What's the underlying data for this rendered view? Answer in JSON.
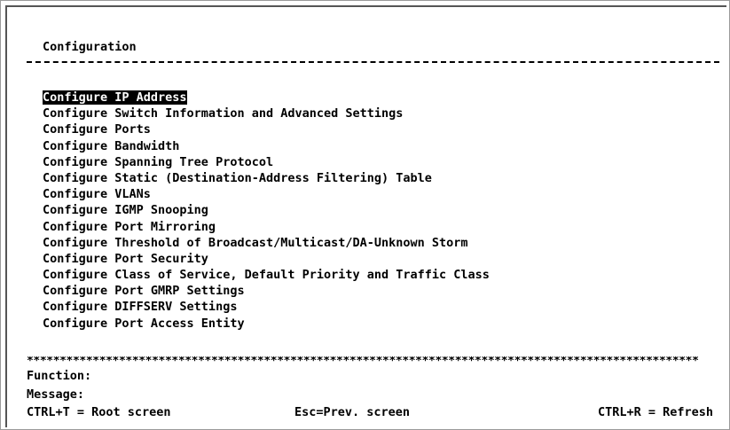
{
  "screen": {
    "title": "Configuration",
    "menu": [
      "Configure IP Address",
      "Configure Switch Information and Advanced Settings",
      "Configure Ports",
      "Configure Bandwidth",
      "Configure Spanning Tree Protocol",
      "Configure Static (Destination-Address Filtering) Table",
      "Configure VLANs",
      "Configure IGMP Snooping",
      "Configure Port Mirroring",
      "Configure Threshold of Broadcast/Multicast/DA-Unknown Storm",
      "Configure Port Security",
      "Configure Class of Service, Default Priority and Traffic Class",
      "Configure Port GMRP Settings",
      "Configure DIFFSERV Settings",
      "Configure Port Access Entity"
    ],
    "selected_index": 0,
    "separator_stars": "******************************************************************************************************",
    "function_label": "Function:",
    "message_label": "Message:",
    "status_root": "CTRL+T = Root screen",
    "status_prev": "Esc=Prev. screen",
    "status_refresh": "CTRL+R = Refresh"
  },
  "colors": {
    "background": "#ffffff",
    "text": "#000000",
    "highlight_bg": "#000000",
    "highlight_fg": "#ffffff"
  }
}
